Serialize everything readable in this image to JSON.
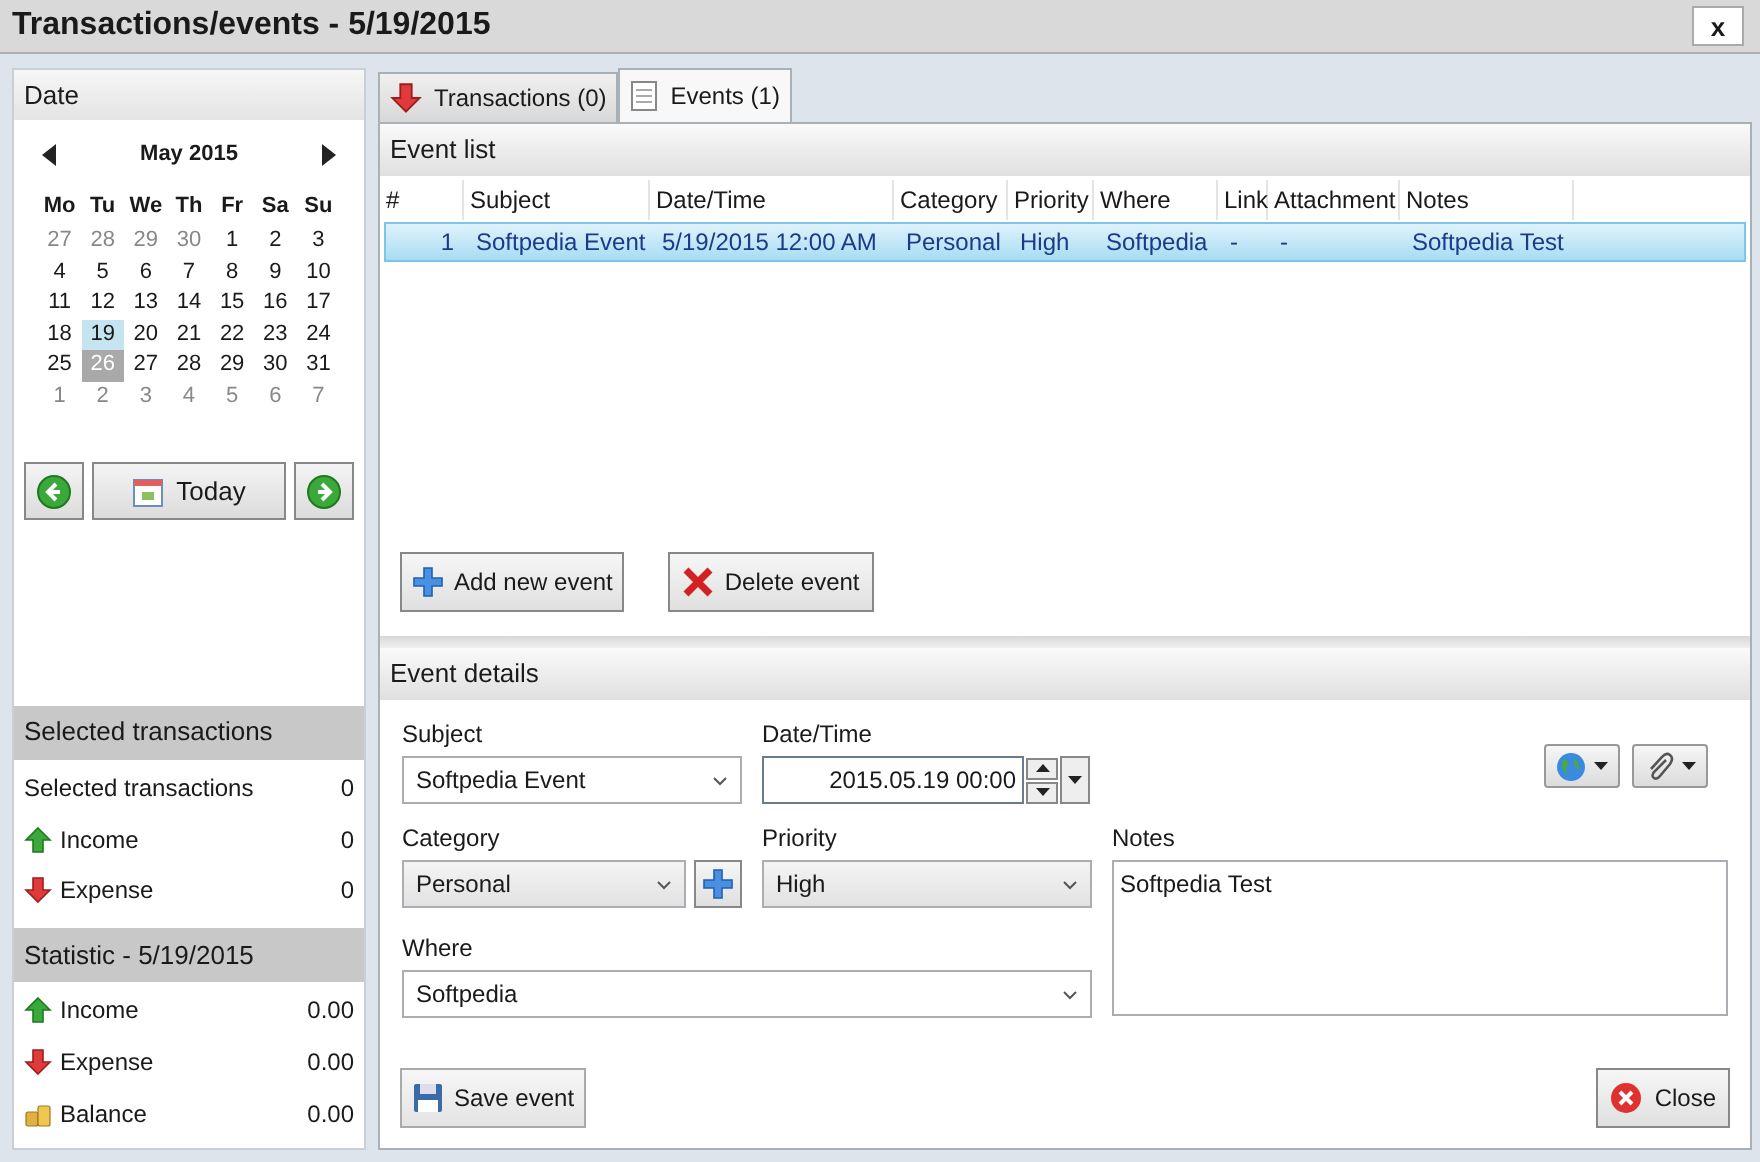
{
  "window": {
    "title": "Transactions/events - 5/19/2015",
    "close": "x"
  },
  "date_panel": {
    "title": "Date",
    "month": "May 2015",
    "weekdays": [
      "Mo",
      "Tu",
      "We",
      "Th",
      "Fr",
      "Sa",
      "Su"
    ],
    "weeks": [
      [
        {
          "text": "27",
          "outside": true
        },
        {
          "text": "28",
          "outside": true
        },
        {
          "text": "29",
          "outside": true
        },
        {
          "text": "30",
          "outside": true
        },
        {
          "text": "1",
          "outside": false
        },
        {
          "text": "2",
          "outside": false
        },
        {
          "text": "3",
          "outside": false
        }
      ],
      [
        {
          "text": "4",
          "outside": false
        },
        {
          "text": "5",
          "outside": false
        },
        {
          "text": "6",
          "outside": false
        },
        {
          "text": "7",
          "outside": false
        },
        {
          "text": "8",
          "outside": false
        },
        {
          "text": "9",
          "outside": false
        },
        {
          "text": "10",
          "outside": false
        }
      ],
      [
        {
          "text": "11",
          "outside": false
        },
        {
          "text": "12",
          "outside": false
        },
        {
          "text": "13",
          "outside": false
        },
        {
          "text": "14",
          "outside": false
        },
        {
          "text": "15",
          "outside": false
        },
        {
          "text": "16",
          "outside": false
        },
        {
          "text": "17",
          "outside": false
        }
      ],
      [
        {
          "text": "18",
          "outside": false
        },
        {
          "text": "19",
          "outside": false,
          "selected": true
        },
        {
          "text": "20",
          "outside": false
        },
        {
          "text": "21",
          "outside": false
        },
        {
          "text": "22",
          "outside": false
        },
        {
          "text": "23",
          "outside": false
        },
        {
          "text": "24",
          "outside": false
        }
      ],
      [
        {
          "text": "25",
          "outside": false
        },
        {
          "text": "26",
          "outside": false,
          "today": true
        },
        {
          "text": "27",
          "outside": false
        },
        {
          "text": "28",
          "outside": false
        },
        {
          "text": "29",
          "outside": false
        },
        {
          "text": "30",
          "outside": false
        },
        {
          "text": "31",
          "outside": false
        }
      ],
      [
        {
          "text": "1",
          "outside": true
        },
        {
          "text": "2",
          "outside": true
        },
        {
          "text": "3",
          "outside": true
        },
        {
          "text": "4",
          "outside": true
        },
        {
          "text": "5",
          "outside": true
        },
        {
          "text": "6",
          "outside": true
        },
        {
          "text": "7",
          "outside": true
        }
      ]
    ],
    "today_button": "Today"
  },
  "selected_transactions": {
    "title": "Selected transactions",
    "rows": [
      {
        "kind": "plain",
        "label": "Selected transactions",
        "value": "0"
      },
      {
        "kind": "income",
        "label": "Income",
        "value": "0"
      },
      {
        "kind": "expense",
        "label": "Expense",
        "value": "0"
      }
    ]
  },
  "statistic": {
    "title": "Statistic - 5/19/2015",
    "rows": [
      {
        "kind": "income",
        "label": "Income",
        "value": "0.00"
      },
      {
        "kind": "expense",
        "label": "Expense",
        "value": "0.00"
      },
      {
        "kind": "balance",
        "label": "Balance",
        "value": "0.00"
      }
    ]
  },
  "tabs": [
    {
      "kind": "transactions",
      "label": "Transactions (0)",
      "selected": false
    },
    {
      "kind": "events",
      "label": "Events (1)",
      "selected": true
    }
  ],
  "event_list": {
    "title": "Event list",
    "columns": [
      "#",
      "Subject",
      "Date/Time",
      "Category",
      "Priority",
      "Where",
      "Link",
      "Attachment",
      "Notes"
    ],
    "rows": [
      {
        "selected": true,
        "cells": [
          "1",
          "Softpedia Event",
          "5/19/2015 12:00 AM",
          "Personal",
          "High",
          "Softpedia",
          "-",
          "-",
          "Softpedia Test"
        ]
      }
    ],
    "add_button": "Add new event",
    "delete_button": "Delete event"
  },
  "event_details": {
    "title": "Event details",
    "subject": {
      "label": "Subject",
      "value": "Softpedia Event"
    },
    "datetime": {
      "label": "Date/Time",
      "value": "2015.05.19 00:00"
    },
    "category": {
      "label": "Category",
      "value": "Personal"
    },
    "priority": {
      "label": "Priority",
      "value": "High"
    },
    "where": {
      "label": "Where",
      "value": "Softpedia"
    },
    "notes": {
      "label": "Notes",
      "value": "Softpedia Test"
    },
    "save_button": "Save event",
    "close_button": "Close"
  }
}
